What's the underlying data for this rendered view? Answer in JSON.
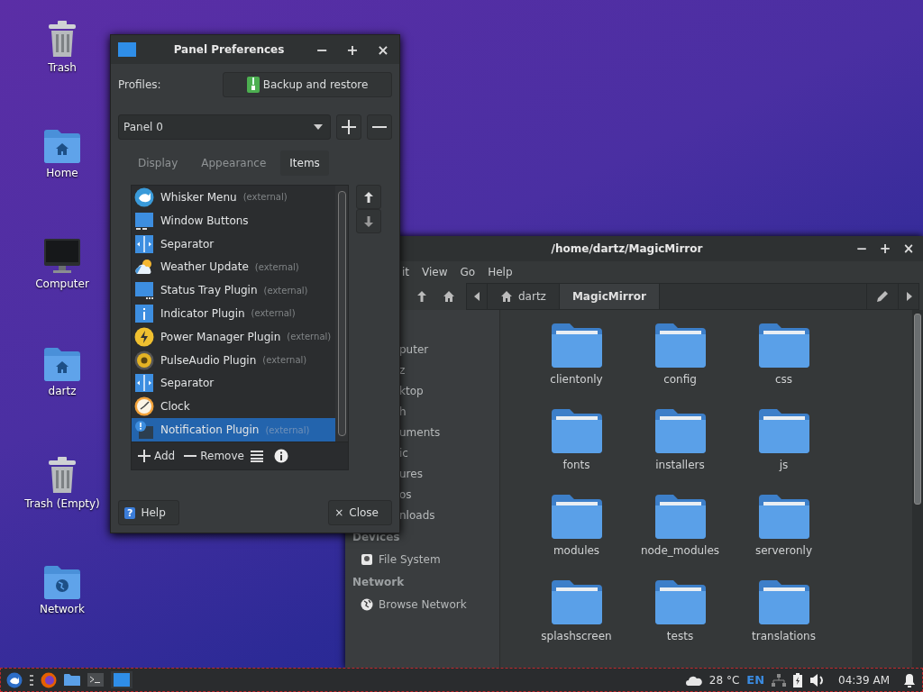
{
  "desktop_icons": [
    {
      "label": "Trash",
      "kind": "trash"
    },
    {
      "label": "Home",
      "kind": "home"
    },
    {
      "label": "Computer",
      "kind": "computer"
    },
    {
      "label": "dartz",
      "kind": "home"
    },
    {
      "label": "Trash (Empty)",
      "kind": "trash"
    },
    {
      "label": "Network",
      "kind": "network"
    }
  ],
  "file_manager": {
    "title": "/home/dartz/MagicMirror",
    "window_buttons": [
      "−",
      "+",
      "×"
    ],
    "menu": [
      "it",
      "View",
      "Go",
      "Help"
    ],
    "path": [
      {
        "label": "dartz",
        "kind": "home",
        "selected": false
      },
      {
        "label": "MagicMirror",
        "kind": "folder",
        "selected": true
      }
    ],
    "sidebar": [
      {
        "items": [
          {
            "label": "puter"
          },
          {
            "label": "z"
          },
          {
            "label": "ktop"
          },
          {
            "label": "h"
          },
          {
            "label": "uments"
          },
          {
            "label": "ic"
          },
          {
            "label": "ures"
          },
          {
            "label": "os"
          },
          {
            "label": "nloads"
          }
        ]
      },
      {
        "heading": "Devices",
        "items": [
          {
            "label": "File System",
            "kind": "drive"
          }
        ]
      },
      {
        "heading": "Network",
        "items": [
          {
            "label": "Browse Network",
            "kind": "globe"
          }
        ]
      }
    ],
    "folders": [
      "clientonly",
      "config",
      "css",
      "fonts",
      "installers",
      "js",
      "modules",
      "node_modules",
      "serveronly",
      "splashscreen",
      "tests",
      "translations"
    ]
  },
  "panel_preferences": {
    "title": "Panel Preferences",
    "window_buttons": [
      "−",
      "+",
      "×"
    ],
    "profiles_label": "Profiles:",
    "backup_button": "Backup and restore",
    "panel_combo": "Panel 0",
    "tabs": [
      {
        "label": "Display",
        "selected": false
      },
      {
        "label": "Appearance",
        "selected": false
      },
      {
        "label": "Items",
        "selected": true
      }
    ],
    "items": [
      {
        "name": "Whisker Menu",
        "note": "(external)",
        "kind": "whisker",
        "selected": false
      },
      {
        "name": "Window Buttons",
        "kind": "window",
        "selected": false
      },
      {
        "name": "Separator",
        "kind": "separator",
        "selected": false
      },
      {
        "name": "Weather Update",
        "note": "(external)",
        "kind": "weather",
        "selected": false
      },
      {
        "name": "Status Tray Plugin",
        "note": "(external)",
        "kind": "tray",
        "selected": false
      },
      {
        "name": "Indicator Plugin",
        "note": "(external)",
        "kind": "indicator",
        "selected": false
      },
      {
        "name": "Power Manager Plugin",
        "note": "(external)",
        "kind": "power",
        "selected": false
      },
      {
        "name": "PulseAudio Plugin",
        "note": "(external)",
        "kind": "audio",
        "selected": false
      },
      {
        "name": "Separator",
        "kind": "separator",
        "selected": false
      },
      {
        "name": "Clock",
        "kind": "clock",
        "selected": false
      },
      {
        "name": "Notification Plugin",
        "note": "(external)",
        "kind": "notification",
        "selected": true
      }
    ],
    "add_button": "Add",
    "remove_button": "Remove",
    "help_button": "Help",
    "help_icon": "?",
    "close_button": "Close",
    "close_icon": "×"
  },
  "taskbar": {
    "temperature": "28 °C",
    "keyboard_layout": "EN",
    "clock": "04:39 AM"
  }
}
